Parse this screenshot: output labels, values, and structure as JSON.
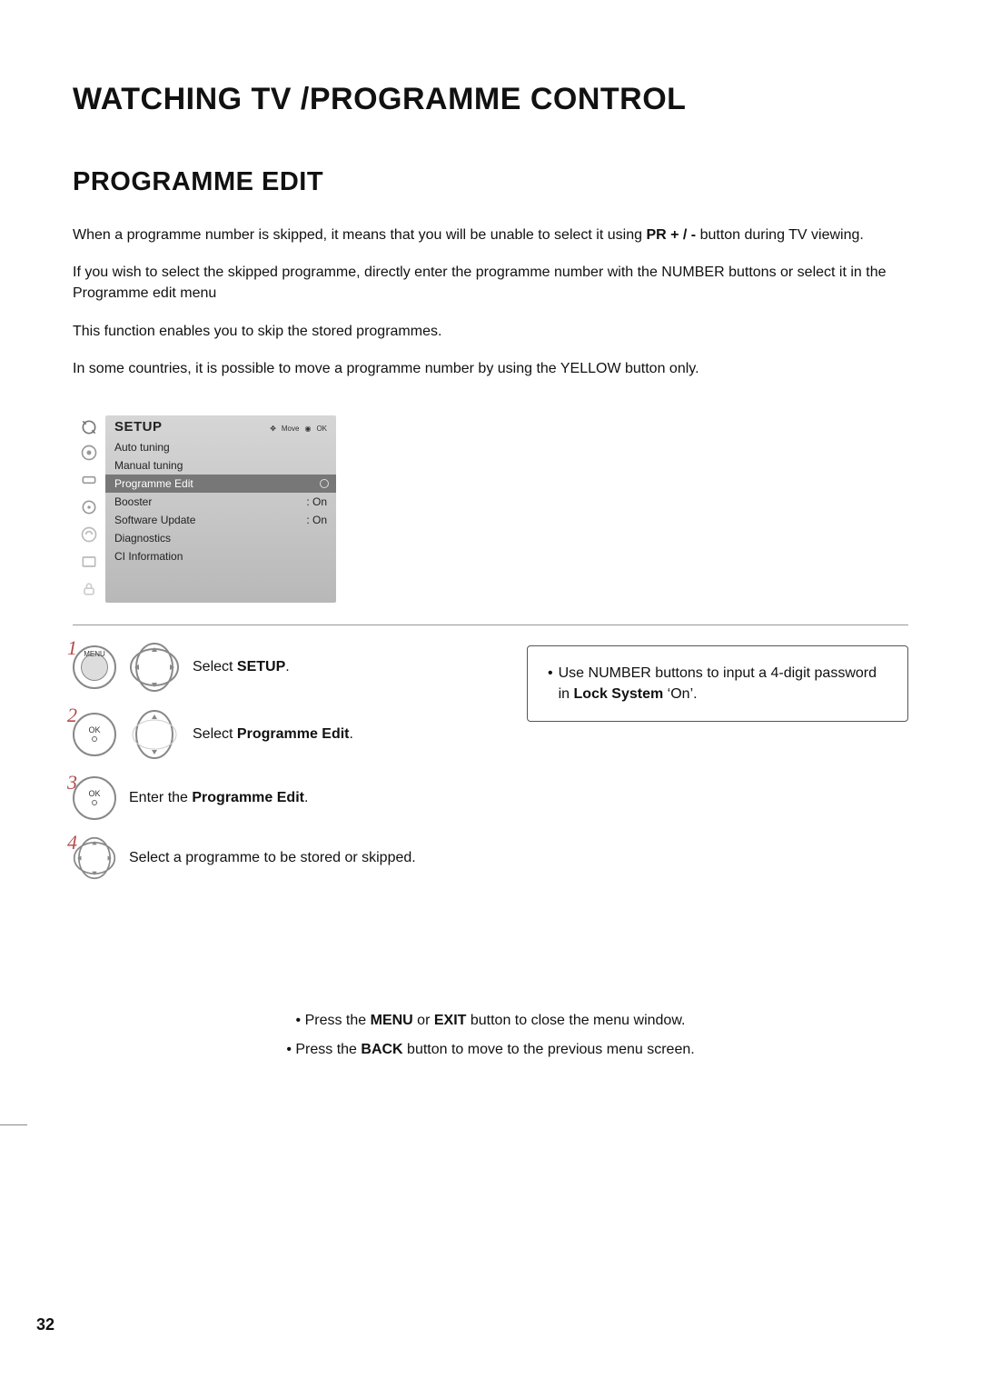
{
  "page_title": "WATCHING TV /PROGRAMME CONTROL",
  "section_title": "PROGRAMME EDIT",
  "intro": {
    "p1_a": "When a programme number is skipped, it means that you will be unable to select it using ",
    "p1_pr": "PR + / -",
    "p1_b": " button during TV viewing.",
    "p2": "If you wish to select the skipped programme, directly enter the programme number with the NUMBER buttons or select it in the Programme edit menu",
    "p3": "This function enables you to skip the stored programmes.",
    "p4": "In some countries, it is possible to move a programme number by using the YELLOW button only."
  },
  "menu": {
    "title": "SETUP",
    "hint_move": "Move",
    "hint_ok": "OK",
    "items": [
      {
        "label": "Auto tuning",
        "value": ""
      },
      {
        "label": "Manual tuning",
        "value": ""
      },
      {
        "label": "Programme Edit",
        "value": "",
        "selected": true
      },
      {
        "label": "Booster",
        "value": ": On"
      },
      {
        "label": "Software Update",
        "value": ": On"
      },
      {
        "label": "Diagnostics",
        "value": ""
      },
      {
        "label": "CI Information",
        "value": ""
      }
    ]
  },
  "steps": {
    "s1": {
      "num": "1",
      "btn_label": "MENU",
      "pre": "Select ",
      "bold": "SETUP",
      "post": "."
    },
    "s2": {
      "num": "2",
      "btn_label": "OK",
      "pre": "Select ",
      "bold": "Programme Edit",
      "post": "."
    },
    "s3": {
      "num": "3",
      "btn_label": "OK",
      "pre": "Enter the ",
      "bold": "Programme Edit",
      "post": "."
    },
    "s4": {
      "num": "4",
      "text": "Select a programme to be stored or skipped."
    }
  },
  "tip": {
    "pre": "Use NUMBER buttons to input a 4-digit password in ",
    "bold": "Lock System",
    "post": " ‘On’."
  },
  "footer": {
    "line1_a": "• Press the ",
    "line1_b1": "MENU",
    "line1_mid": " or ",
    "line1_b2": "EXIT",
    "line1_c": " button to close the menu window.",
    "line2_a": "• Press the ",
    "line2_b": "BACK",
    "line2_c": " button to move to the previous menu screen."
  },
  "page_number": "32"
}
